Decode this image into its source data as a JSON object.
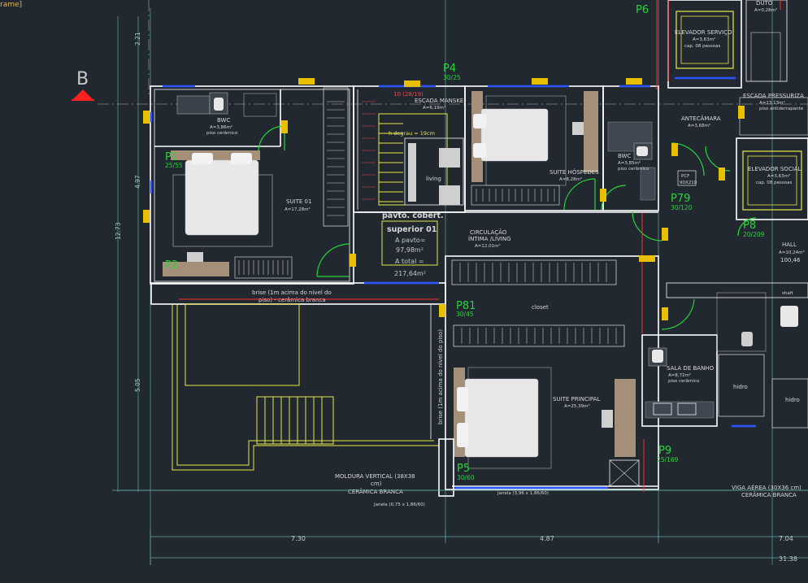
{
  "viewport_menu": "rame]",
  "section_marker": {
    "letter": "B"
  },
  "rooms": {
    "bwc1": {
      "name": "BWC",
      "area": "A=3,86m²",
      "floor": "piso cerâmico"
    },
    "suite01": {
      "name": "SUITE 01",
      "area": "A=17,28m²"
    },
    "escada": {
      "name": "ESCADA MANSKE",
      "area": "A=6,19m²",
      "degraus": "h degrau = 19cm"
    },
    "living_small": {
      "name": "living"
    },
    "suite_hospedes": {
      "name": "SUITE HÓSPEDES",
      "area": "A=8,28m²"
    },
    "bwc2": {
      "name": "BWC",
      "area": "A=3,85m²",
      "floor": "piso cerâmico"
    },
    "antecamara": {
      "name": "ANTECÂMARA",
      "area": "A=3,68m²"
    },
    "circulacao": {
      "name": "CIRCULAÇÃO",
      "subtitle": "ÍNTIMA /LIVING",
      "area": "A=12,01m²"
    },
    "closet": {
      "name": "closet"
    },
    "suite_principal": {
      "name": "SUITE PRINCIPAL",
      "area": "A=25,39m²"
    },
    "sala_banho": {
      "name": "SALA DE BANHO",
      "area": "A=8,72m²",
      "floor": "piso cerâmico"
    },
    "hall": {
      "name": "HALL",
      "area": "A=10,24m²",
      "level": "100,46"
    },
    "elev_servico": {
      "name": "ELEVADOR SERVIÇO",
      "area": "A=3,63m²",
      "cap": "cap. 08 pessoas"
    },
    "elev_social": {
      "name": "ELEVADOR SOCIAL",
      "area": "A=3,63m²",
      "cap": "cap. 08 pessoas"
    },
    "escada_press": {
      "name": "ESCADA PRESSURIZA",
      "area": "A=13,13m²",
      "floor": "piso antiderrapante"
    },
    "duto": {
      "name": "DUTO",
      "area": "A=0,28m²"
    },
    "shaft": {
      "name": "shaft"
    },
    "hidro1": {
      "name": "hidro"
    },
    "hidro2": {
      "name": "hidro"
    }
  },
  "pillars": {
    "P1": {
      "id": "P1",
      "size": "25/55"
    },
    "P2": {
      "id": "P2",
      "size": ""
    },
    "P4": {
      "id": "P4",
      "size": "30/25"
    },
    "P5": {
      "id": "P5",
      "size": "30/60"
    },
    "P6": {
      "id": "P6",
      "size": ""
    },
    "P8": {
      "id": "P8",
      "size": "20/209"
    },
    "P9": {
      "id": "P9",
      "size": "25/169"
    },
    "P79": {
      "id": "P79",
      "size": "30/120"
    },
    "P81": {
      "id": "P81",
      "size": "30/45"
    }
  },
  "area_box": {
    "title1": "pavto. cobert.",
    "title2": "superior 01",
    "label1": "A pavto=",
    "value1": "97,98m²",
    "label2": "A total =",
    "value2": "217,64m²"
  },
  "notes": {
    "brise_h1": "brise (1m acima do nível do",
    "brise_h2": "piso) - cerâmica branca",
    "brise_v": "brise (1m acima do nível do piso)",
    "moldura1": "MOLDURA VERTICAL (38X38",
    "moldura2": "cm)",
    "moldura3": "CERÂMICA BRANCA",
    "viga1": "VIGA AÉREA (30X36 cm)",
    "viga2": "CERÂMICA BRANCA",
    "janela1": "Janela (0,75 x 1,86/60)",
    "janela2": "Janela (3,96 x 1,86/60)",
    "pcf": "PCF",
    "pcf2": "90X210",
    "stair_dim": "10 (28/19)"
  },
  "dimensions": {
    "left_221": "2.21",
    "left_497": "4.97",
    "left_1273": "12.73",
    "left_505": "5.05",
    "bottom_730": "7.30",
    "bottom_487": "4.87",
    "bottom_704": "7.04",
    "bottom_3138": "31.38"
  },
  "colors": {
    "background": "#212830",
    "wall": "#ffffff",
    "pillar_label": "#27d43a",
    "window": "#2b56ff",
    "dimension": "#5fa7a0",
    "brise": "#e8e84a",
    "red_lines": "#ff3030"
  }
}
